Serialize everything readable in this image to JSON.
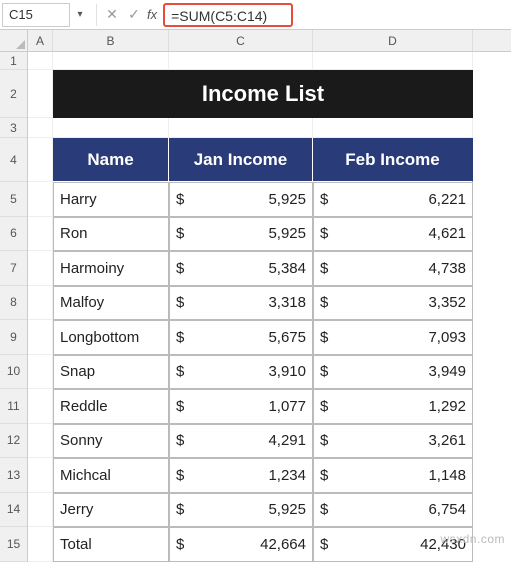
{
  "name_box": "C15",
  "formula": "=SUM(C5:C14)",
  "fx_label": "fx",
  "columns": [
    "A",
    "B",
    "C",
    "D"
  ],
  "title": "Income List",
  "headers": {
    "name": "Name",
    "jan": "Jan Income",
    "feb": "Feb Income"
  },
  "currency": "$",
  "rows": [
    {
      "name": "Harry",
      "jan": "5,925",
      "feb": "6,221"
    },
    {
      "name": "Ron",
      "jan": "5,925",
      "feb": "4,621"
    },
    {
      "name": "Harmoiny",
      "jan": "5,384",
      "feb": "4,738"
    },
    {
      "name": "Malfoy",
      "jan": "3,318",
      "feb": "3,352"
    },
    {
      "name": "Longbottom",
      "jan": "5,675",
      "feb": "7,093"
    },
    {
      "name": "Snap",
      "jan": "3,910",
      "feb": "3,949"
    },
    {
      "name": "Reddle",
      "jan": "1,077",
      "feb": "1,292"
    },
    {
      "name": "Sonny",
      "jan": "4,291",
      "feb": "3,261"
    },
    {
      "name": "Michcal",
      "jan": "1,234",
      "feb": "1,148"
    },
    {
      "name": "Jerry",
      "jan": "5,925",
      "feb": "6,754"
    }
  ],
  "total_label": "Total",
  "totals": {
    "jan": "42,664",
    "feb": "42,430"
  },
  "watermark": "wsxdn.com",
  "chart_data": {
    "type": "table",
    "title": "Income List",
    "columns": [
      "Name",
      "Jan Income",
      "Feb Income"
    ],
    "data": [
      [
        "Harry",
        5925,
        6221
      ],
      [
        "Ron",
        5925,
        4621
      ],
      [
        "Harmoiny",
        5384,
        4738
      ],
      [
        "Malfoy",
        3318,
        3352
      ],
      [
        "Longbottom",
        5675,
        7093
      ],
      [
        "Snap",
        3910,
        3949
      ],
      [
        "Reddle",
        1077,
        1292
      ],
      [
        "Sonny",
        4291,
        3261
      ],
      [
        "Michcal",
        1234,
        1148
      ],
      [
        "Jerry",
        5925,
        6754
      ],
      [
        "Total",
        42664,
        42430
      ]
    ]
  }
}
